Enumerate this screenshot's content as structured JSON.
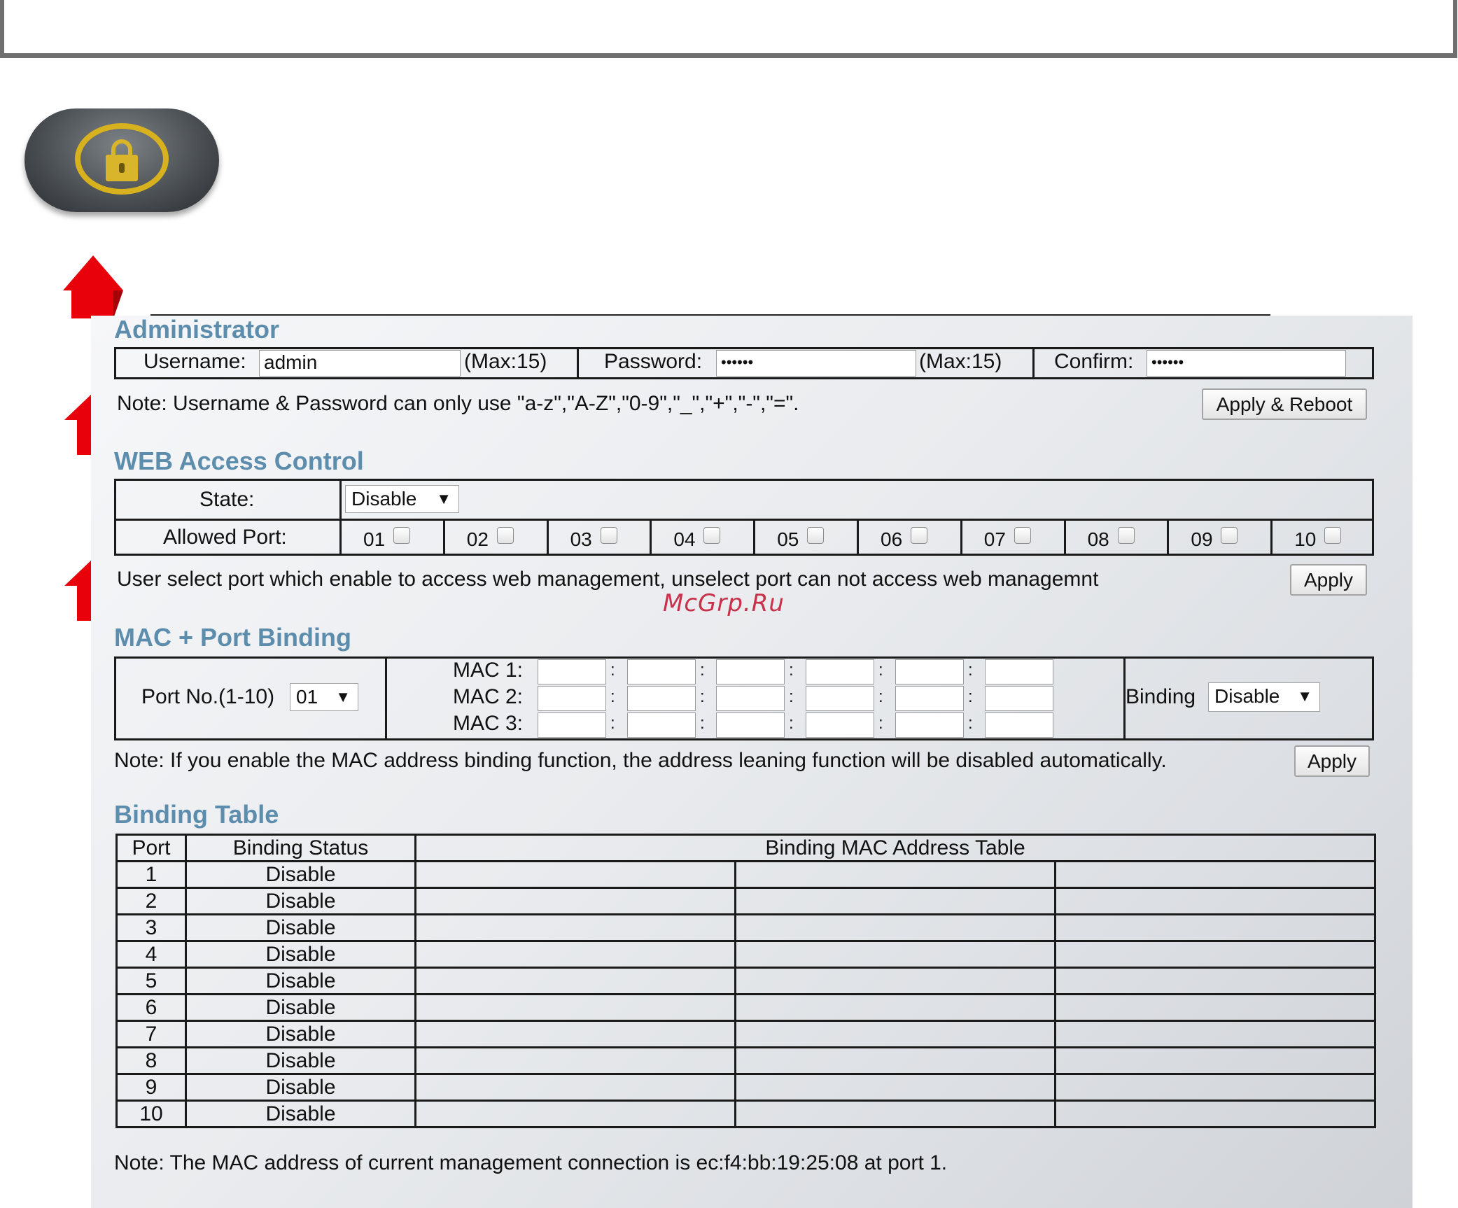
{
  "watermark": "McGrp.Ru",
  "icons": {
    "lock": "lock-icon",
    "arrow": "red-up-arrow-icon"
  },
  "colors": {
    "section_title": "#5d8dad",
    "lock_gold": "#d7b21e",
    "arrow_red": "#e8000b"
  },
  "admin": {
    "title": "Administrator",
    "username_label": "Username:",
    "username_value": "admin",
    "max1": "(Max:15)",
    "password_label": "Password:",
    "password_value": "••••••",
    "max2": "(Max:15)",
    "confirm_label": "Confirm:",
    "confirm_value": "••••••",
    "note": "Note: Username & Password can only use \"a-z\",\"A-Z\",\"0-9\",\"_\",\"+\",\"-\",\"=\".",
    "apply_reboot": "Apply & Reboot"
  },
  "web": {
    "title": "WEB Access Control",
    "state_label": "State:",
    "state_value": "Disable",
    "allowed_label": "Allowed Port:",
    "ports": [
      "01",
      "02",
      "03",
      "04",
      "05",
      "06",
      "07",
      "08",
      "09",
      "10"
    ],
    "note": "User select port which enable to access web management, unselect port can not access web managemnt",
    "apply": "Apply"
  },
  "mac": {
    "title": "MAC + Port Binding",
    "port_label": "Port No.(1-10)",
    "port_value": "01",
    "mac1": "MAC 1:",
    "mac2": "MAC 2:",
    "mac3": "MAC 3:",
    "binding_label": "Binding",
    "binding_value": "Disable",
    "note": "Note: If you enable the MAC address binding function, the address leaning function will be disabled automatically.",
    "apply": "Apply"
  },
  "table": {
    "title": "Binding Table",
    "headers": [
      "Port",
      "Binding Status",
      "Binding MAC Address Table"
    ],
    "rows": [
      {
        "port": "1",
        "status": "Disable"
      },
      {
        "port": "2",
        "status": "Disable"
      },
      {
        "port": "3",
        "status": "Disable"
      },
      {
        "port": "4",
        "status": "Disable"
      },
      {
        "port": "5",
        "status": "Disable"
      },
      {
        "port": "6",
        "status": "Disable"
      },
      {
        "port": "7",
        "status": "Disable"
      },
      {
        "port": "8",
        "status": "Disable"
      },
      {
        "port": "9",
        "status": "Disable"
      },
      {
        "port": "10",
        "status": "Disable"
      }
    ],
    "note": "Note: The MAC address of current management connection is ec:f4:bb:19:25:08 at port 1."
  }
}
